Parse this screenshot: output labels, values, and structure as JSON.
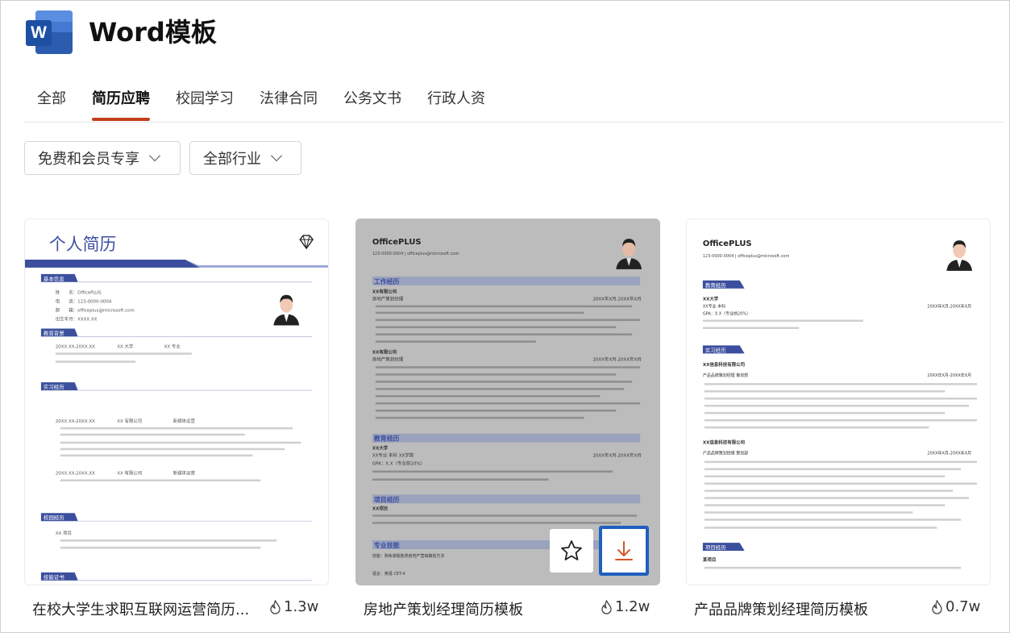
{
  "header": {
    "app_icon_letter": "W",
    "title": "Word模板"
  },
  "tabs": [
    {
      "label": "全部",
      "active": false
    },
    {
      "label": "简历应聘",
      "active": true
    },
    {
      "label": "校园学习",
      "active": false
    },
    {
      "label": "法律合同",
      "active": false
    },
    {
      "label": "公务文书",
      "active": false
    },
    {
      "label": "行政人资",
      "active": false
    }
  ],
  "filters": {
    "membership": "免费和会员专享",
    "industry": "全部行业"
  },
  "cards": [
    {
      "title": "在校大学生求职互联网运营简历...",
      "count": "1.3w",
      "preview": {
        "heading": "个人简历",
        "sections": [
          "基本信息",
          "教育背景",
          "实习经历",
          "校园经历",
          "技能证书"
        ],
        "name": "姓　　名：OfficePLUS",
        "phone": "电　　话：123-0000-0004",
        "email": "邮　　箱：officeplus@microsoft.com",
        "birth": "出生年月：XXXX.XX",
        "edu_line": "20XX.XX-20XX.XX　　　　　XX 大学　　　　　　　XX 专业",
        "intern_line": "20XX.XX-20XX.XX　　　　　XX 有限公司　　　　　　　新媒体运营",
        "intern_line2": "20XX.XX-20XX.XX　　　　　XX 有限公司　　　　　　　新媒体运营",
        "campus_line": "XX 项目"
      }
    },
    {
      "title": "房地产策划经理简历模板",
      "count": "1.2w",
      "preview": {
        "brand": "OfficePLUS",
        "contact": "123-0000-0004 | officeplus@microsoft.com",
        "sections": [
          "工作经历",
          "教育经历",
          "项目经历",
          "专业技能"
        ],
        "company1": "XX有限公司",
        "role1": "房地产策划经理",
        "date1": "20XX年X月-20XX年X月",
        "company2": "XX有限公司",
        "role2": "房地产策划经理",
        "date2": "20XX年X月-20XX年X月",
        "school": "XX大学",
        "degree": "XX专业 本科 XX学院",
        "date3": "20XX年X月-20XX年X月",
        "gpa": "GPA：X.X（专业前10%）",
        "project": "XX项目",
        "skill1": "技能：熟练掌握各类房地产营销策划方法",
        "skill2": "语言：英语 CET-4"
      }
    },
    {
      "title": "产品品牌策划经理简历模板",
      "count": "0.7w",
      "preview": {
        "brand": "OfficePLUS",
        "contact": "123-0000-0004 | officeplus@microsoft.com",
        "sections": [
          "教育经历",
          "实习经历",
          "项目经历"
        ],
        "school": "XX大学",
        "degree": "XX专业 本科",
        "gpa": "GPA：X.X（专业前20%）",
        "date1": "20XX年X月-20XX年X月",
        "company1": "XX信息科技有限公司",
        "role1": "产品品牌策划经理 策划部",
        "date2": "20XX年X月-20XX年X月",
        "company2": "XX信息科技有限公司",
        "role2": "产品品牌策划经理 策划部",
        "date3": "20XX年X月-20XX年X月",
        "project": "某项目"
      }
    }
  ],
  "colors": {
    "accent": "#c43e1c",
    "word_blue": "#2b5cad",
    "resume_blue": "#3b4f9e",
    "download_orange": "#d9542b",
    "focus_border": "#1f5fbf"
  }
}
